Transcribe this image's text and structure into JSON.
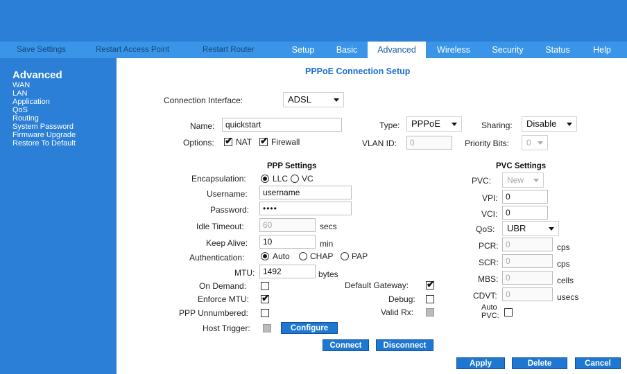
{
  "nav": {
    "utility": [
      "Save Settings",
      "Restart Access Point",
      "Restart Router"
    ],
    "tabs": [
      "Setup",
      "Basic",
      "Advanced",
      "Wireless",
      "Security",
      "Status",
      "Help"
    ],
    "active_tab": "Advanced"
  },
  "sidebar": {
    "title": "Advanced",
    "items": [
      "WAN",
      "LAN",
      "Application",
      "QoS",
      "Routing",
      "System Password",
      "Firmware Upgrade",
      "Restore To Default"
    ]
  },
  "page": {
    "heading": "PPPoE Connection Setup"
  },
  "connection": {
    "interface_label": "Connection Interface:",
    "interface_value": "ADSL"
  },
  "general": {
    "name_label": "Name:",
    "name_value": "quickstart",
    "type_label": "Type:",
    "type_value": "PPPoE",
    "sharing_label": "Sharing:",
    "sharing_value": "Disable",
    "options_label": "Options:",
    "nat_label": "NAT",
    "firewall_label": "Firewall",
    "vlan_label": "VLAN ID:",
    "vlan_value": "0",
    "priority_label": "Priority Bits:",
    "priority_value": "0"
  },
  "ppp": {
    "title": "PPP Settings",
    "encapsulation_label": "Encapsulation:",
    "llc_label": "LLC",
    "vc_label": "VC",
    "username_label": "Username:",
    "username_value": "username",
    "password_label": "Password:",
    "password_value": "••••",
    "idle_label": "Idle Timeout:",
    "idle_value": "60",
    "idle_unit": "secs",
    "keepalive_label": "Keep Alive:",
    "keepalive_value": "10",
    "keepalive_unit": "min",
    "auth_label": "Authentication:",
    "auth_auto": "Auto",
    "auth_chap": "CHAP",
    "auth_pap": "PAP",
    "mtu_label": "MTU:",
    "mtu_value": "1492",
    "mtu_unit": "bytes",
    "ondemand_label": "On Demand:",
    "enforce_label": "Enforce MTU:",
    "unnumbered_label": "PPP Unnumbered:",
    "hosttrigger_label": "Host Trigger:",
    "configure_label": "Configure",
    "gateway_label": "Default Gateway:",
    "debug_label": "Debug:",
    "validrx_label": "Valid Rx:"
  },
  "pvc": {
    "title": "PVC Settings",
    "pvc_label": "PVC:",
    "pvc_value": "New",
    "vpi_label": "VPI:",
    "vpi_value": "0",
    "vci_label": "VCI:",
    "vci_value": "0",
    "qos_label": "QoS:",
    "qos_value": "UBR",
    "pcr_label": "PCR:",
    "pcr_value": "0",
    "pcr_unit": "cps",
    "scr_label": "SCR:",
    "scr_value": "0",
    "scr_unit": "cps",
    "mbs_label": "MBS:",
    "mbs_value": "0",
    "mbs_unit": "cells",
    "cdvt_label": "CDVT:",
    "cdvt_value": "0",
    "cdvt_unit": "usecs",
    "autopvc_label_1": "Auto",
    "autopvc_label_2": "PVC:"
  },
  "actions": {
    "connect": "Connect",
    "disconnect": "Disconnect",
    "apply": "Apply",
    "delete": "Delete",
    "cancel": "Cancel"
  },
  "colors": {
    "banner": "#2b7fd6",
    "navbar": "#3a95e8",
    "button": "#1e78d2",
    "heading": "#1f6fcc"
  }
}
